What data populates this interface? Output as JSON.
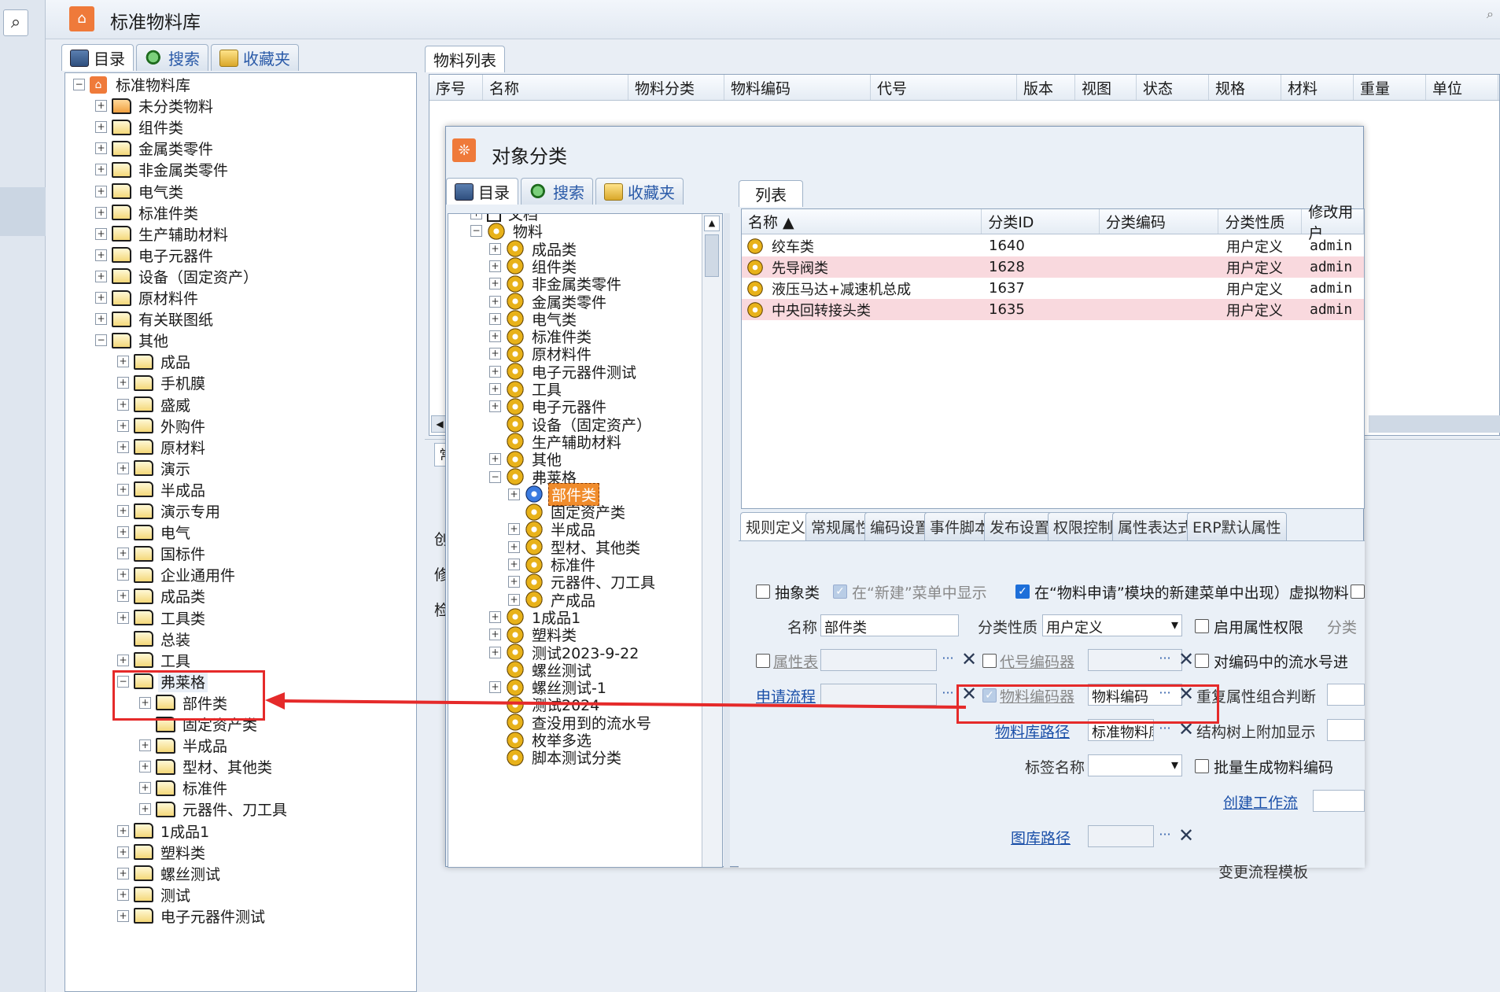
{
  "app": {
    "title": "标准物料库"
  },
  "left_tabs": [
    {
      "label": "目录"
    },
    {
      "label": "搜索"
    },
    {
      "label": "收藏夹"
    }
  ],
  "left_tree": [
    {
      "label": "标准物料库",
      "level": 0,
      "exp": "-",
      "icon": "root"
    },
    {
      "label": "未分类物料",
      "level": 1,
      "exp": "+",
      "icon": "special"
    },
    {
      "label": "组件类",
      "level": 1,
      "exp": "+"
    },
    {
      "label": "金属类零件",
      "level": 1,
      "exp": "+"
    },
    {
      "label": "非金属类零件",
      "level": 1,
      "exp": "+"
    },
    {
      "label": "电气类",
      "level": 1,
      "exp": "+"
    },
    {
      "label": "标准件类",
      "level": 1,
      "exp": "+"
    },
    {
      "label": "生产辅助材料",
      "level": 1,
      "exp": "+"
    },
    {
      "label": "电子元器件",
      "level": 1,
      "exp": "+"
    },
    {
      "label": "设备（固定资产）",
      "level": 1,
      "exp": "+"
    },
    {
      "label": "原材料件",
      "level": 1,
      "exp": "+"
    },
    {
      "label": "有关联图纸",
      "level": 1,
      "exp": "+"
    },
    {
      "label": "其他",
      "level": 1,
      "exp": "-"
    },
    {
      "label": "成品",
      "level": 2,
      "exp": "+"
    },
    {
      "label": "手机膜",
      "level": 2,
      "exp": "+"
    },
    {
      "label": "盛威",
      "level": 2,
      "exp": "+"
    },
    {
      "label": "外购件",
      "level": 2,
      "exp": "+"
    },
    {
      "label": "原材料",
      "level": 2,
      "exp": "+"
    },
    {
      "label": "演示",
      "level": 2,
      "exp": "+"
    },
    {
      "label": "半成品",
      "level": 2,
      "exp": "+"
    },
    {
      "label": "演示专用",
      "level": 2,
      "exp": "+"
    },
    {
      "label": "电气",
      "level": 2,
      "exp": "+"
    },
    {
      "label": "国标件",
      "level": 2,
      "exp": "+"
    },
    {
      "label": "企业通用件",
      "level": 2,
      "exp": "+"
    },
    {
      "label": "成品类",
      "level": 2,
      "exp": "+"
    },
    {
      "label": "工具类",
      "level": 2,
      "exp": "+"
    },
    {
      "label": "总装",
      "level": 2,
      "exp": ""
    },
    {
      "label": "工具",
      "level": 2,
      "exp": "+"
    },
    {
      "label": "弗莱格",
      "level": 2,
      "exp": "-",
      "selected": true
    },
    {
      "label": "部件类",
      "level": 3,
      "exp": "+"
    },
    {
      "label": "固定资产类",
      "level": 3,
      "exp": ""
    },
    {
      "label": "半成品",
      "level": 3,
      "exp": "+"
    },
    {
      "label": "型材、其他类",
      "level": 3,
      "exp": "+"
    },
    {
      "label": "标准件",
      "level": 3,
      "exp": "+"
    },
    {
      "label": "元器件、刀工具",
      "level": 3,
      "exp": "+"
    },
    {
      "label": "1成品1",
      "level": 2,
      "exp": "+"
    },
    {
      "label": "塑料类",
      "level": 2,
      "exp": "+"
    },
    {
      "label": "螺丝测试",
      "level": 2,
      "exp": "+"
    },
    {
      "label": "测试",
      "level": 2,
      "exp": "+"
    },
    {
      "label": "电子元器件测试",
      "level": 2,
      "exp": "+"
    }
  ],
  "material_list": {
    "tab": "物料列表",
    "columns": [
      "序号",
      "名称",
      "物料分类",
      "物料编码",
      "代号",
      "版本",
      "视图",
      "状态",
      "规格",
      "材料",
      "重量",
      "单位"
    ]
  },
  "bg_fragments": [
    "创",
    "修",
    "检",
    "常"
  ],
  "dialog": {
    "title": "对象分类",
    "tabs": [
      {
        "label": "目录"
      },
      {
        "label": "搜索"
      },
      {
        "label": "收藏夹"
      }
    ],
    "tree": [
      {
        "label": "文档",
        "level": 0,
        "exp": "+",
        "icon": "doc"
      },
      {
        "label": "物料",
        "level": 0,
        "exp": "-"
      },
      {
        "label": "成品类",
        "level": 1,
        "exp": "+"
      },
      {
        "label": "组件类",
        "level": 1,
        "exp": "+"
      },
      {
        "label": "非金属类零件",
        "level": 1,
        "exp": "+"
      },
      {
        "label": "金属类零件",
        "level": 1,
        "exp": "+"
      },
      {
        "label": "电气类",
        "level": 1,
        "exp": "+"
      },
      {
        "label": "标准件类",
        "level": 1,
        "exp": "+"
      },
      {
        "label": "原材料件",
        "level": 1,
        "exp": "+"
      },
      {
        "label": "电子元器件测试",
        "level": 1,
        "exp": "+"
      },
      {
        "label": "工具",
        "level": 1,
        "exp": "+"
      },
      {
        "label": "电子元器件",
        "level": 1,
        "exp": "+"
      },
      {
        "label": "设备（固定资产）",
        "level": 1,
        "exp": ""
      },
      {
        "label": "生产辅助材料",
        "level": 1,
        "exp": ""
      },
      {
        "label": "其他",
        "level": 1,
        "exp": "+"
      },
      {
        "label": "弗莱格",
        "level": 1,
        "exp": "-"
      },
      {
        "label": "部件类",
        "level": 2,
        "exp": "+",
        "highlight": true
      },
      {
        "label": "固定资产类",
        "level": 2,
        "exp": ""
      },
      {
        "label": "半成品",
        "level": 2,
        "exp": "+"
      },
      {
        "label": "型材、其他类",
        "level": 2,
        "exp": "+"
      },
      {
        "label": "标准件",
        "level": 2,
        "exp": "+"
      },
      {
        "label": "元器件、刀工具",
        "level": 2,
        "exp": "+"
      },
      {
        "label": "产成品",
        "level": 2,
        "exp": "+"
      },
      {
        "label": "1成品1",
        "level": 1,
        "exp": "+"
      },
      {
        "label": "塑料类",
        "level": 1,
        "exp": "+"
      },
      {
        "label": "测试2023-9-22",
        "level": 1,
        "exp": "+"
      },
      {
        "label": "螺丝测试",
        "level": 1,
        "exp": ""
      },
      {
        "label": "螺丝测试-1",
        "level": 1,
        "exp": "+"
      },
      {
        "label": "测试2024",
        "level": 1,
        "exp": ""
      },
      {
        "label": "查没用到的流水号",
        "level": 1,
        "exp": ""
      },
      {
        "label": "枚举多选",
        "level": 1,
        "exp": ""
      },
      {
        "label": "脚本测试分类",
        "level": 1,
        "exp": ""
      }
    ],
    "list": {
      "tab": "列表",
      "columns": [
        "名称",
        "分类ID",
        "分类编码",
        "分类性质",
        "修改用户"
      ],
      "rows": [
        {
          "name": "绞车类",
          "id": "1640",
          "code": "",
          "nature": "用户定义",
          "user": "admin",
          "pink": false
        },
        {
          "name": "先导阀类",
          "id": "1628",
          "code": "",
          "nature": "用户定义",
          "user": "admin",
          "pink": true
        },
        {
          "name": "液压马达+减速机总成",
          "id": "1637",
          "code": "",
          "nature": "用户定义",
          "user": "admin",
          "pink": false
        },
        {
          "name": "中央回转接头类",
          "id": "1635",
          "code": "",
          "nature": "用户定义",
          "user": "admin",
          "pink": true
        }
      ]
    },
    "prop_tabs": [
      "规则定义",
      "常规属性",
      "编码设置",
      "事件脚本",
      "发布设置",
      "权限控制",
      "属性表达式",
      "ERP默认属性"
    ],
    "form": {
      "abstract_class": "抽象类",
      "show_in_new_menu": "在“新建”菜单中显示",
      "show_in_material_request": "在“物料申请”模块的新建菜单中出现）虚拟物料",
      "name_label": "名称",
      "name_value": "部件类",
      "nature_label": "分类性质",
      "nature_value": "用户定义",
      "enable_attr_perm": "启用属性权限",
      "class_cut": "分类",
      "attr_table": "属性表",
      "code_gen": "代号编码器",
      "serial_check": "对编码中的流水号进",
      "apply_flow": "申请流程",
      "material_coder": "物料编码器",
      "material_coder_value": "物料编码",
      "dup_attr_check": "重复属性组合判断",
      "lib_path": "物料库路径",
      "lib_path_value": "标准物料库\\其他\\弗莱格\\部件类",
      "struct_tree_extra": "结构树上附加显示",
      "tag_name": "标签名称",
      "batch_gen": "批量生成物料编码",
      "create_workflow": "创建工作流",
      "drawing_path": "图库路径",
      "change_flow_template": "变更流程模板"
    }
  },
  "colors": {
    "accent_orange": "#ef7a3a",
    "annotation_red": "#e52a2a",
    "link_blue": "#1a4fa8",
    "pink_row": "#f9d9de"
  }
}
